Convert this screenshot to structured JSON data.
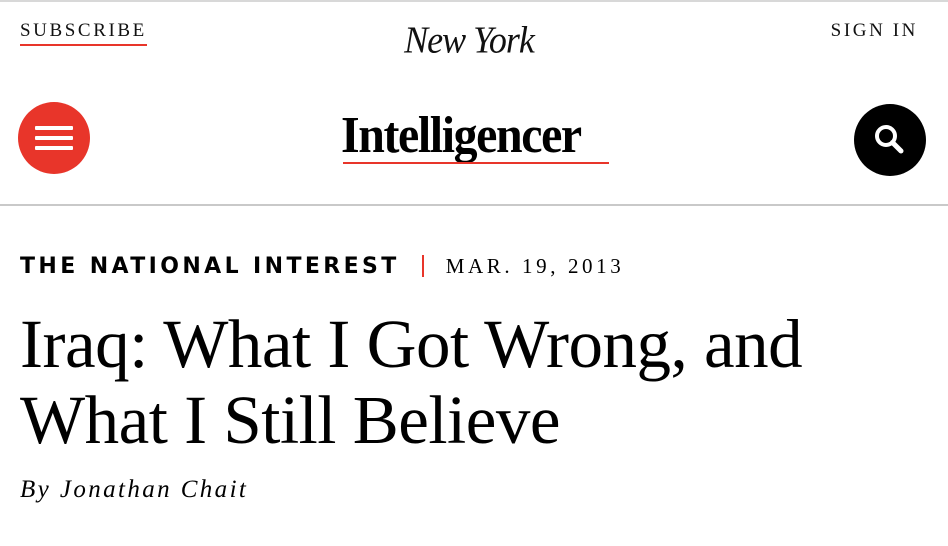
{
  "top_bar": {
    "subscribe_label": "SUBSCRIBE",
    "brand": "New York",
    "signin_label": "SIGN IN"
  },
  "header": {
    "section_logo": "Intelligencer",
    "menu_icon": "hamburger-menu-icon",
    "search_icon": "search-icon"
  },
  "article": {
    "rubric": "THE NATIONAL INTEREST",
    "date": "MAR. 19, 2013",
    "headline": "Iraq: What I Got Wrong, and What I Still Believe",
    "byline": "By Jonathan Chait"
  },
  "colors": {
    "accent": "#e8352a",
    "text": "#000000",
    "divider": "#c9c9c9"
  }
}
